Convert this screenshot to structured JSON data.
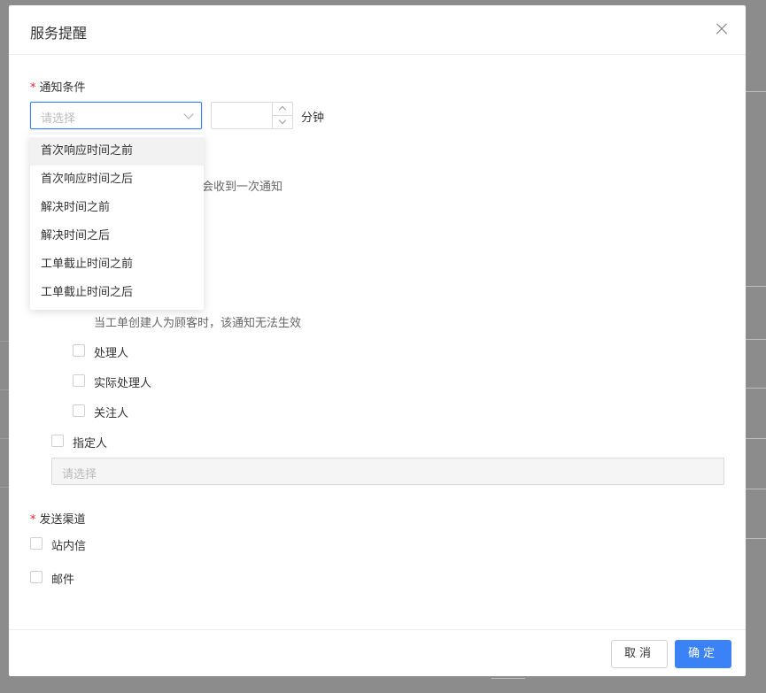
{
  "modal": {
    "title": "服务提醒",
    "close_icon": "close-icon"
  },
  "condition": {
    "label": "通知条件",
    "select_placeholder": "请选择",
    "unit": "分钟",
    "partial_hint": "会收到一次通知",
    "dropdown_options": [
      "首次响应时间之前",
      "首次响应时间之后",
      "解决时间之前",
      "解决时间之后",
      "工单截止时间之前",
      "工单截止时间之后"
    ]
  },
  "recipients": {
    "customer_hint": "当工单创建人为顾客时，该通知无法生效",
    "options": [
      "处理人",
      "实际处理人",
      "关注人"
    ],
    "designated_label": "指定人",
    "designated_placeholder": "请选择"
  },
  "channels": {
    "label": "发送渠道",
    "options": [
      "站内信",
      "邮件"
    ]
  },
  "footer": {
    "cancel": "取消",
    "ok": "确定"
  },
  "colors": {
    "primary": "#3b82f6",
    "required": "#f5222d"
  }
}
